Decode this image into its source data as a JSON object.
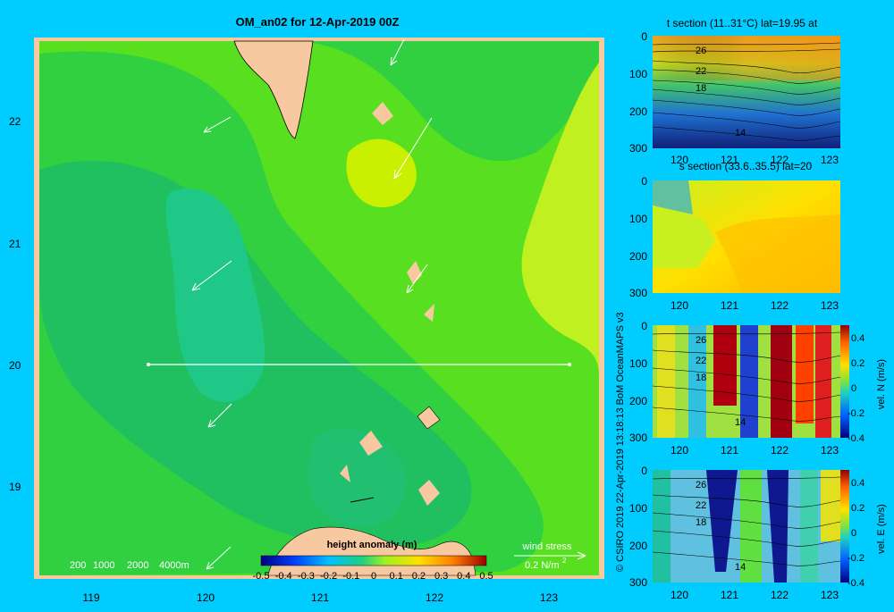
{
  "main": {
    "title": "OM_an02 for 12-Apr-2019 00Z",
    "x_ticks": [
      "119",
      "120",
      "121",
      "122",
      "123"
    ],
    "y_ticks": [
      "22",
      "21",
      "20",
      "19"
    ],
    "depth_legend": [
      "200",
      "1000",
      "2000",
      "4000m"
    ],
    "colorbar_title": "height anomaly (m)",
    "colorbar_ticks": [
      "-0.5",
      "-0.4",
      "-0.3",
      "-0.2",
      "-0.1",
      "0",
      "0.1",
      "0.2",
      "0.3",
      "0.4",
      "0.5"
    ],
    "wind_label": "wind stress",
    "wind_value": "0.2 N/m",
    "wind_exp": "2",
    "colors": {
      "land": "#f8c8a0",
      "water_low": "#20c880",
      "water_high": "#ccff00",
      "frame": "#f8c8a0"
    }
  },
  "chart_data": [
    {
      "type": "heatmap",
      "title": "OM_an02 for 12-Apr-2019 00Z",
      "variable": "height anomaly (m)",
      "xlim": [
        118.5,
        123.5
      ],
      "ylim": [
        18.3,
        22.7
      ],
      "colorbar_range": [
        -0.5,
        0.5
      ],
      "section_line": {
        "lat": 20,
        "lon_start": 119.5,
        "lon_end": 123.2
      }
    },
    {
      "type": "heatmap",
      "title": "t section (11..31°C) lat=19.95 at",
      "xticks": [
        "120",
        "121",
        "122",
        "123"
      ],
      "yticks": [
        "0",
        "100",
        "200",
        "300"
      ],
      "contour_labels": [
        "26",
        "22",
        "18",
        "14"
      ]
    },
    {
      "type": "heatmap",
      "title": "s section (33.6..35.5) lat=20",
      "xticks": [
        "120",
        "121",
        "122",
        "123"
      ],
      "yticks": [
        "0",
        "100",
        "200",
        "300"
      ]
    },
    {
      "type": "heatmap",
      "title": "vel. N (m/s)",
      "xticks": [
        "120",
        "121",
        "122",
        "123"
      ],
      "yticks": [
        "0",
        "100",
        "200",
        "300"
      ],
      "contour_labels": [
        "26",
        "22",
        "18",
        "14"
      ],
      "colorbar_ticks": [
        "0.4",
        "0.2",
        "0",
        "-0.2",
        "-0.4"
      ]
    },
    {
      "type": "heatmap",
      "title": "vel. E (m/s)",
      "xticks": [
        "120",
        "121",
        "122",
        "123"
      ],
      "yticks": [
        "0",
        "100",
        "200",
        "300"
      ],
      "contour_labels": [
        "26",
        "22",
        "18",
        "14"
      ],
      "colorbar_ticks": [
        "0.4",
        "0.2",
        "0",
        "-0.2",
        "-0.4"
      ]
    }
  ],
  "side": {
    "t_title": "t section (11..31°C) lat=19.95 at",
    "s_title": "s section (33.6..35.5) lat=20",
    "vn_label": "vel. N (m/s)",
    "ve_label": "vel. E (m/s)",
    "credit": "© CSIRO 2019   22-Apr-2019 13:18:13 BoM OceanMAPS v3"
  }
}
